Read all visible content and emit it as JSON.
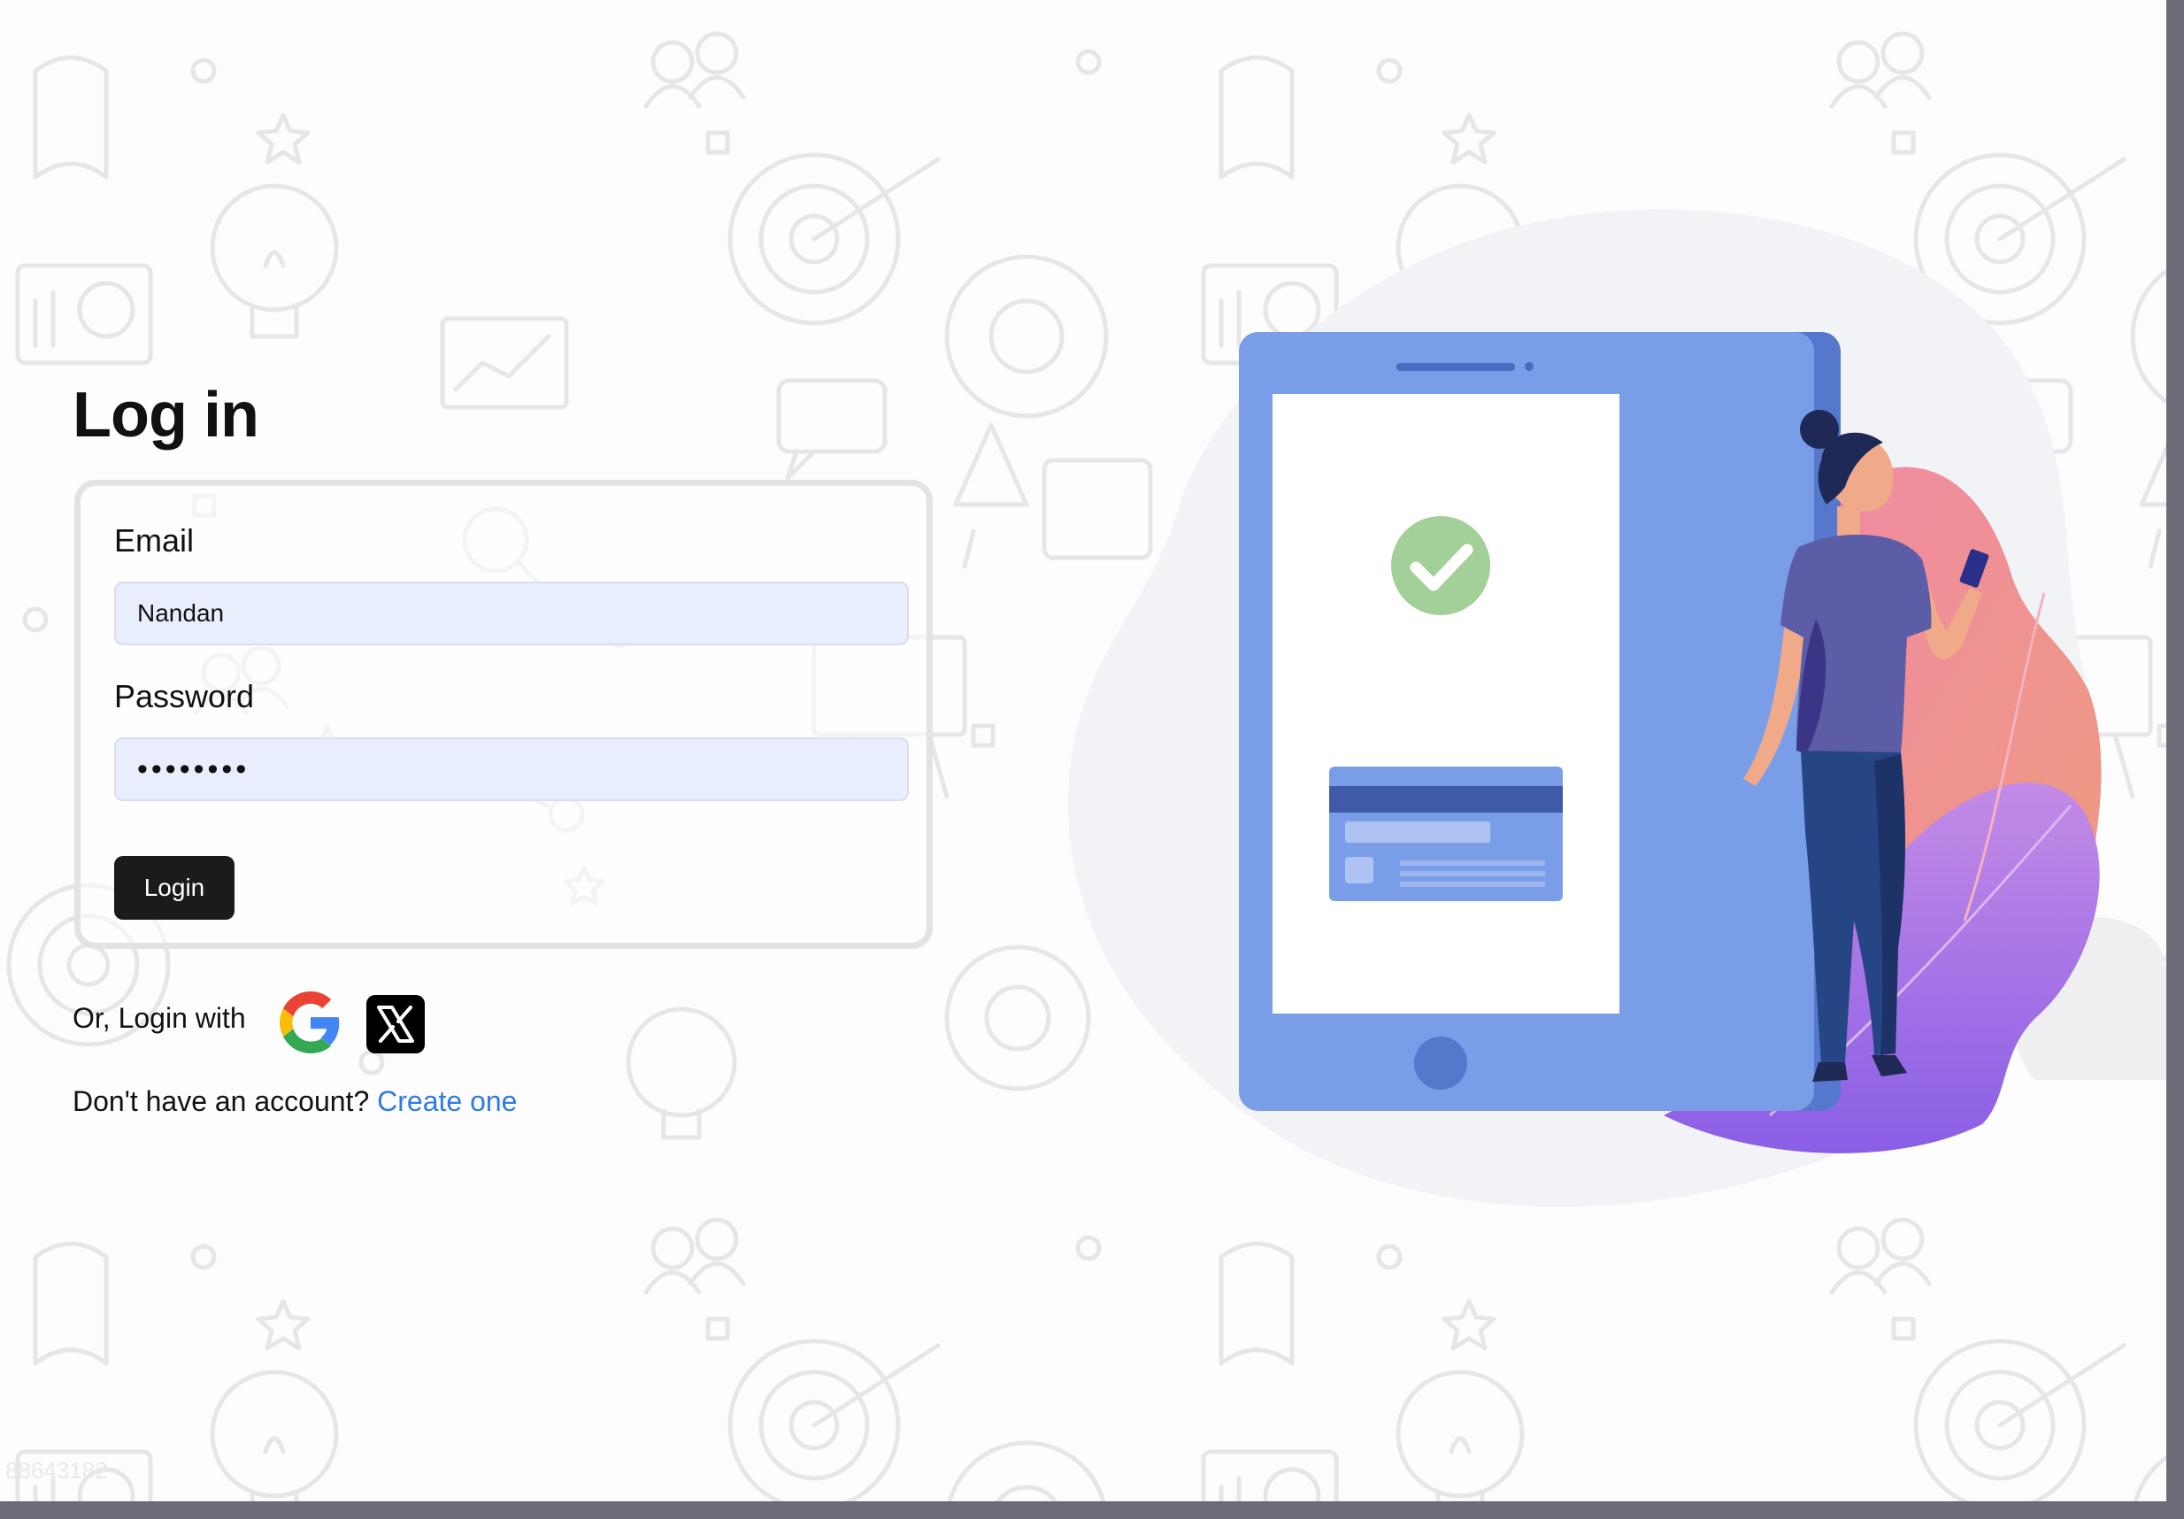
{
  "page": {
    "title": "Log in"
  },
  "form": {
    "email_label": "Email",
    "email_value": "Nandan",
    "password_label": "Password",
    "password_value": "••••••••",
    "login_label": "Login"
  },
  "social": {
    "label": "Or, Login with",
    "providers": [
      {
        "name": "google-icon"
      },
      {
        "name": "x-icon"
      }
    ]
  },
  "signup": {
    "prompt": "Don't have an account?",
    "link": "Create one"
  },
  "corner_mark": "88643182",
  "colors": {
    "primary_button": "#1b1b1d",
    "link": "#2f7be6",
    "input_bg": "#e8eefc",
    "phone": "#7a9de8",
    "check": "#a3cf98"
  }
}
